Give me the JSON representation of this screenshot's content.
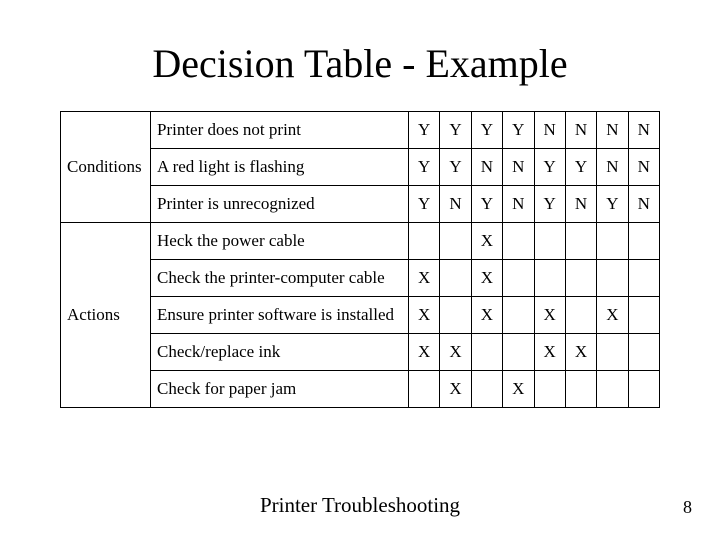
{
  "title": "Decision Table - Example",
  "sections": {
    "conditions_label": "Conditions",
    "actions_label": "Actions"
  },
  "rows": {
    "c1": {
      "label": "Printer does not print",
      "v": [
        "Y",
        "Y",
        "Y",
        "Y",
        "N",
        "N",
        "N",
        "N"
      ]
    },
    "c2": {
      "label": "A red light is flashing",
      "v": [
        "Y",
        "Y",
        "N",
        "N",
        "Y",
        "Y",
        "N",
        "N"
      ]
    },
    "c3": {
      "label": "Printer is unrecognized",
      "v": [
        "Y",
        "N",
        "Y",
        "N",
        "Y",
        "N",
        "Y",
        "N"
      ]
    },
    "a1": {
      "label": "Heck the power cable",
      "v": [
        "",
        "",
        "X",
        "",
        "",
        "",
        "",
        ""
      ]
    },
    "a2": {
      "label": "Check the printer-computer cable",
      "v": [
        "X",
        "",
        "X",
        "",
        "",
        "",
        "",
        ""
      ]
    },
    "a3": {
      "label": "Ensure printer software is installed",
      "v": [
        "X",
        "",
        "X",
        "",
        "X",
        "",
        "X",
        ""
      ]
    },
    "a4": {
      "label": "Check/replace ink",
      "v": [
        "X",
        "X",
        "",
        "",
        "X",
        "X",
        "",
        ""
      ]
    },
    "a5": {
      "label": "Check for paper jam",
      "v": [
        "",
        "X",
        "",
        "X",
        "",
        "",
        "",
        ""
      ]
    }
  },
  "footer": {
    "caption": "Printer Troubleshooting",
    "page": "8"
  }
}
